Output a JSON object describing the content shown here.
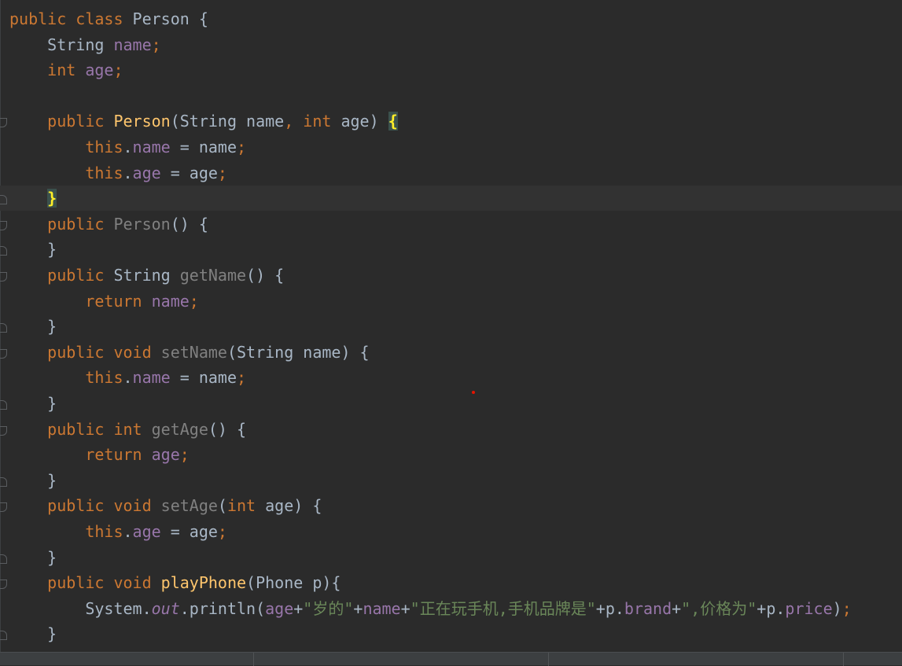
{
  "editor": {
    "file_language": "Java",
    "current_line": 8,
    "lines": [
      [
        [
          "kw",
          "public "
        ],
        [
          "kw",
          "class "
        ],
        [
          "",
          "Person {"
        ]
      ],
      [
        [
          "",
          "    String "
        ],
        [
          "fld",
          "name"
        ],
        [
          "kw",
          ";"
        ]
      ],
      [
        [
          "kw",
          "    int "
        ],
        [
          "fld",
          "age"
        ],
        [
          "kw",
          ";"
        ]
      ],
      [],
      [
        [
          "kw",
          "    public "
        ],
        [
          "fn",
          "Person"
        ],
        [
          "",
          "(String name"
        ],
        [
          "kw",
          ", "
        ],
        [
          "kw",
          "int "
        ],
        [
          "",
          "age) "
        ],
        [
          "brace-hl",
          "{"
        ]
      ],
      [
        [
          "kw",
          "        this"
        ],
        [
          "",
          "."
        ],
        [
          "fld",
          "name"
        ],
        [
          "",
          " = name"
        ],
        [
          "kw",
          ";"
        ]
      ],
      [
        [
          "kw",
          "        this"
        ],
        [
          "",
          "."
        ],
        [
          "fld",
          "age"
        ],
        [
          "",
          " = age"
        ],
        [
          "kw",
          ";"
        ]
      ],
      [
        [
          "",
          "    "
        ],
        [
          "brace-hl",
          "}"
        ]
      ],
      [
        [
          "kw",
          "    public "
        ],
        [
          "unused",
          "Person"
        ],
        [
          "",
          "() {"
        ]
      ],
      [
        [
          "",
          "    }"
        ]
      ],
      [
        [
          "kw",
          "    public "
        ],
        [
          "",
          "String "
        ],
        [
          "unused",
          "getName"
        ],
        [
          "",
          "() {"
        ]
      ],
      [
        [
          "kw",
          "        return "
        ],
        [
          "fld",
          "name"
        ],
        [
          "kw",
          ";"
        ]
      ],
      [
        [
          "",
          "    }"
        ]
      ],
      [
        [
          "kw",
          "    public "
        ],
        [
          "kw",
          "void "
        ],
        [
          "unused",
          "setName"
        ],
        [
          "",
          "(String name) {"
        ]
      ],
      [
        [
          "kw",
          "        this"
        ],
        [
          "",
          "."
        ],
        [
          "fld",
          "name"
        ],
        [
          "",
          " = name"
        ],
        [
          "kw",
          ";"
        ]
      ],
      [
        [
          "",
          "    }"
        ]
      ],
      [
        [
          "kw",
          "    public "
        ],
        [
          "kw",
          "int "
        ],
        [
          "unused",
          "getAge"
        ],
        [
          "",
          "() {"
        ]
      ],
      [
        [
          "kw",
          "        return "
        ],
        [
          "fld",
          "age"
        ],
        [
          "kw",
          ";"
        ]
      ],
      [
        [
          "",
          "    }"
        ]
      ],
      [
        [
          "kw",
          "    public "
        ],
        [
          "kw",
          "void "
        ],
        [
          "unused",
          "setAge"
        ],
        [
          "",
          "("
        ],
        [
          "kw",
          "int "
        ],
        [
          "",
          "age) {"
        ]
      ],
      [
        [
          "kw",
          "        this"
        ],
        [
          "",
          "."
        ],
        [
          "fld",
          "age"
        ],
        [
          "",
          " = age"
        ],
        [
          "kw",
          ";"
        ]
      ],
      [
        [
          "",
          "    }"
        ]
      ],
      [
        [
          "kw",
          "    public "
        ],
        [
          "kw",
          "void "
        ],
        [
          "fn",
          "playPhone"
        ],
        [
          "",
          "(Phone p){"
        ]
      ],
      [
        [
          "",
          "        System."
        ],
        [
          "st",
          "out"
        ],
        [
          "",
          ".println("
        ],
        [
          "fld",
          "age"
        ],
        [
          "",
          "+"
        ],
        [
          "str",
          "\"岁的\""
        ],
        [
          "",
          "+"
        ],
        [
          "fld",
          "name"
        ],
        [
          "",
          "+"
        ],
        [
          "str",
          "\"正在玩手机,手机品牌是\""
        ],
        [
          "",
          "+p."
        ],
        [
          "fld",
          "brand"
        ],
        [
          "",
          "+"
        ],
        [
          "str",
          "\",价格为\""
        ],
        [
          "",
          "+p."
        ],
        [
          "fld",
          "price"
        ],
        [
          "",
          ")"
        ],
        [
          "kw",
          ";"
        ]
      ],
      [
        [
          "",
          "    }"
        ]
      ]
    ]
  },
  "colors": {
    "background": "#2b2b2b",
    "keyword": "#cc7832",
    "field": "#9876aa",
    "method_decl": "#ffc66d",
    "unused": "#808080",
    "string": "#6a8759",
    "text": "#a9b7c6"
  }
}
